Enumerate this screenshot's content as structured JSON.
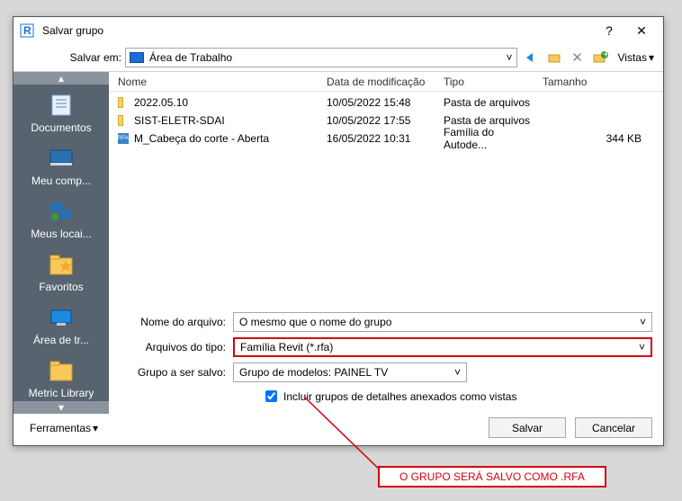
{
  "titlebar": {
    "title": "Salvar grupo"
  },
  "topbar": {
    "saveInLabel": "Salvar em:",
    "path": "Área de Trabalho",
    "vistasLabel": "Vistas"
  },
  "sidebar": {
    "items": [
      {
        "label": "Documentos"
      },
      {
        "label": "Meu comp..."
      },
      {
        "label": "Meus locai..."
      },
      {
        "label": "Favoritos"
      },
      {
        "label": "Área de tr..."
      },
      {
        "label": "Metric Library"
      }
    ]
  },
  "list": {
    "headers": {
      "name": "Nome",
      "date": "Data de modificação",
      "type": "Tipo",
      "size": "Tamanho"
    },
    "rows": [
      {
        "icon": "folder",
        "name": "2022.05.10",
        "date": "10/05/2022 15:48",
        "type": "Pasta de arquivos",
        "size": ""
      },
      {
        "icon": "folder",
        "name": "SIST-ELETR-SDAI",
        "date": "10/05/2022 17:55",
        "type": "Pasta de arquivos",
        "size": ""
      },
      {
        "icon": "rfa",
        "name": "M_Cabeça do corte - Aberta",
        "date": "16/05/2022 10:31",
        "type": "Família do Autode...",
        "size": "344 KB"
      }
    ]
  },
  "fields": {
    "filenameLabel": "Nome do arquivo:",
    "filenameValue": "O mesmo que o nome do grupo",
    "filetypeLabel": "Arquivos do tipo:",
    "filetypeValue": "Família Revit  (*.rfa)",
    "groupLabel": "Grupo a ser salvo:",
    "groupValue": "Grupo de modelos: PAINEL TV",
    "checkboxLabel": "Incluir grupos de detalhes anexados como vistas"
  },
  "footer": {
    "tools": "Ferramentas",
    "save": "Salvar",
    "cancel": "Cancelar"
  },
  "callout": "O GRUPO SERÁ SALVO COMO .RFA"
}
